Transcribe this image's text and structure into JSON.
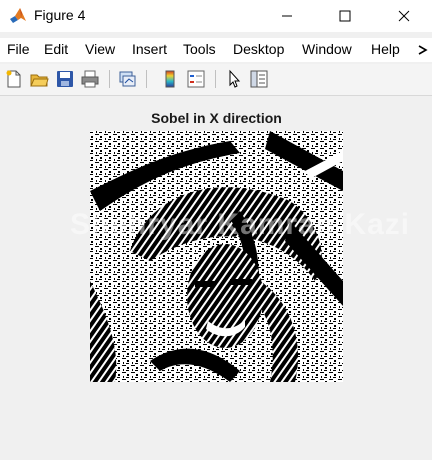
{
  "window": {
    "title": "Figure 4",
    "icon": "matlab-logo-icon",
    "controls": [
      "minimize-icon",
      "maximize-icon",
      "close-icon"
    ]
  },
  "menubar": {
    "items": [
      "File",
      "Edit",
      "View",
      "Insert",
      "Tools",
      "Desktop",
      "Window",
      "Help"
    ],
    "overflow_icon": "chevron-right-icon"
  },
  "toolbar": {
    "buttons": [
      "new-figure-icon",
      "open-file-icon",
      "save-icon",
      "print-icon",
      "link-plot-icon",
      "insert-colorbar-icon",
      "insert-legend-icon",
      "edit-plot-arrow-icon",
      "open-property-inspector-icon"
    ]
  },
  "axes": {
    "title": "Sobel in X direction",
    "image_description_icon": "sobel-edge-image"
  },
  "overlay": {
    "watermark": "Shehryar Kamran Kazi"
  }
}
